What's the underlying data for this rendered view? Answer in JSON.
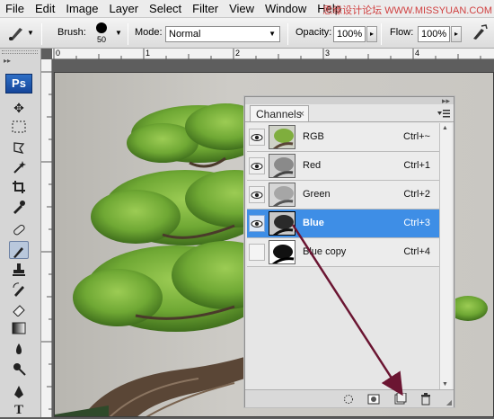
{
  "menubar": {
    "items": [
      "File",
      "Edit",
      "Image",
      "Layer",
      "Select",
      "Filter",
      "View",
      "Window",
      "Help"
    ],
    "watermark": "思缘设计论坛 WWW.MISSYUAN.COM"
  },
  "options": {
    "brush_label": "Brush:",
    "brush_size": "50",
    "mode_label": "Mode:",
    "mode_value": "Normal",
    "opacity_label": "Opacity:",
    "opacity_value": "100%",
    "flow_label": "Flow:",
    "flow_value": "100%"
  },
  "ruler": {
    "top_ticks": [
      "0",
      "1",
      "2",
      "3",
      "4"
    ]
  },
  "toolbox": {
    "logo": "Ps",
    "tools": [
      "move-tool",
      "marquee-tool",
      "lasso-tool",
      "magic-wand-tool",
      "crop-tool",
      "eyedropper-tool",
      "healing-brush-tool",
      "brush-tool",
      "clone-stamp-tool",
      "history-brush-tool",
      "eraser-tool",
      "gradient-tool",
      "blur-tool",
      "dodge-tool",
      "pen-tool",
      "type-tool"
    ]
  },
  "channels": {
    "tab_label": "Channels",
    "rows": [
      {
        "name": "RGB",
        "shortcut": "Ctrl+~",
        "visible": true,
        "selected": false
      },
      {
        "name": "Red",
        "shortcut": "Ctrl+1",
        "visible": true,
        "selected": false
      },
      {
        "name": "Green",
        "shortcut": "Ctrl+2",
        "visible": true,
        "selected": false
      },
      {
        "name": "Blue",
        "shortcut": "Ctrl+3",
        "visible": true,
        "selected": true
      },
      {
        "name": "Blue copy",
        "shortcut": "Ctrl+4",
        "visible": false,
        "selected": false
      }
    ],
    "bottom_buttons": [
      "load-selection-icon",
      "save-selection-icon",
      "new-channel-icon",
      "delete-channel-icon"
    ]
  },
  "colors": {
    "selection": "#3e8ee6",
    "arrow": "#6b1532",
    "foliage": "#6fa834"
  }
}
